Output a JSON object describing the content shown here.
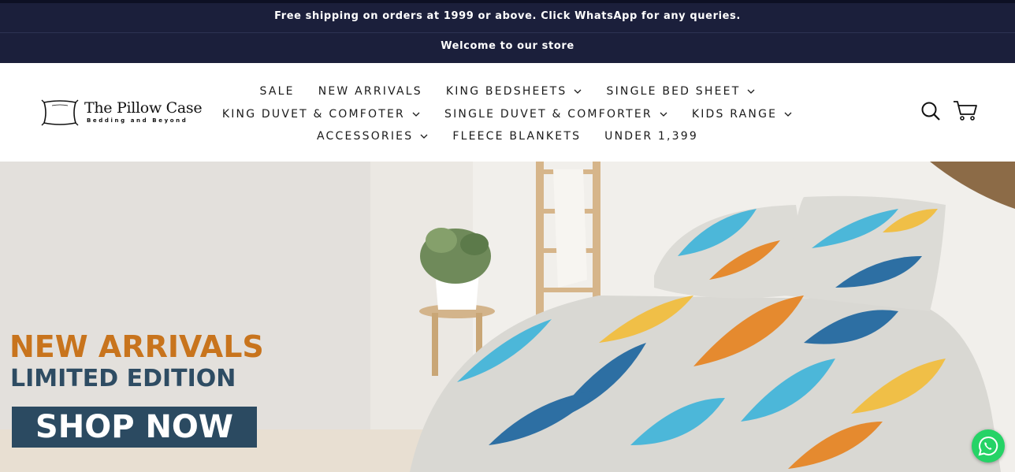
{
  "announcements": {
    "line1": "Free shipping on orders at 1999 or above. Click WhatsApp for any queries.",
    "line2": "Welcome to our store"
  },
  "logo": {
    "name": "The Pillow Case",
    "tagline": "Bedding and Beyond",
    "icon": "pillow-icon"
  },
  "nav": {
    "row1": [
      {
        "label": "SALE",
        "dropdown": false
      },
      {
        "label": "NEW ARRIVALS",
        "dropdown": false
      },
      {
        "label": "KING BEDSHEETS",
        "dropdown": true
      },
      {
        "label": "SINGLE BED SHEET",
        "dropdown": true
      }
    ],
    "row2": [
      {
        "label": "KING DUVET & COMFOTER",
        "dropdown": true
      },
      {
        "label": "SINGLE DUVET & COMFORTER",
        "dropdown": true
      },
      {
        "label": "KIDS RANGE",
        "dropdown": true
      }
    ],
    "row3": [
      {
        "label": "ACCESSORIES",
        "dropdown": true
      },
      {
        "label": "FLEECE BLANKETS",
        "dropdown": false
      },
      {
        "label": "UNDER 1,399",
        "dropdown": false
      }
    ]
  },
  "header_icons": [
    "search-icon",
    "cart-icon"
  ],
  "hero": {
    "title": "NEW ARRIVALS",
    "subtitle": "LIMITED EDITION",
    "cta": "SHOP NOW"
  },
  "floating": {
    "icon": "whatsapp-icon"
  },
  "colors": {
    "topbar": "#1b1f3b",
    "hero_title": "#c8741d",
    "hero_subtitle": "#2e4c63",
    "cta_bg": "#2b4a61",
    "whatsapp": "#25d366"
  }
}
